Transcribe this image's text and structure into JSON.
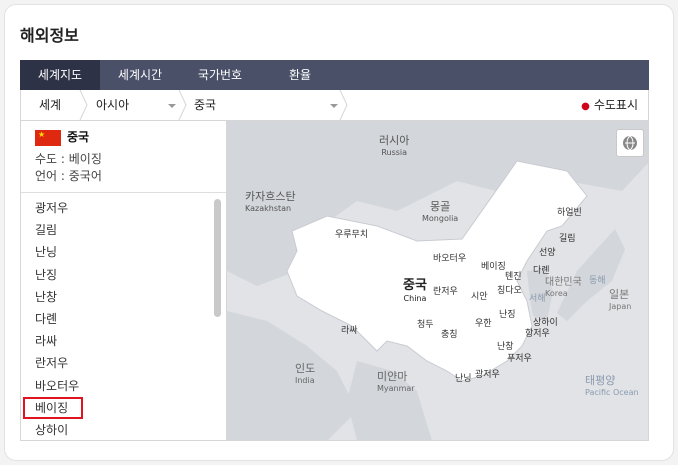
{
  "page": {
    "title": "해외정보"
  },
  "tabs": [
    {
      "label": "세계지도",
      "active": true
    },
    {
      "label": "세계시간",
      "active": false
    },
    {
      "label": "국가번호",
      "active": false
    },
    {
      "label": "환율",
      "active": false
    }
  ],
  "breadcrumb": {
    "world": "세계",
    "region": "아시아",
    "country": "중국"
  },
  "capital_toggle": "수도표시",
  "country_info": {
    "name": "중국",
    "capital": "수도 : 베이징",
    "language": "언어 : 중국어"
  },
  "cities": [
    "광저우",
    "길림",
    "난닝",
    "난징",
    "난창",
    "다롄",
    "라싸",
    "란저우",
    "바오터우",
    "베이징",
    "상하이"
  ],
  "selected_city": "베이징",
  "map": {
    "labels": {
      "russia_ko": "러시아",
      "russia_en": "Russia",
      "kazakhstan_ko": "카자흐스탄",
      "kazakhstan_en": "Kazakhstan",
      "mongolia_ko": "몽골",
      "mongolia_en": "Mongolia",
      "china_ko": "중국",
      "china_en": "China",
      "korea_ko": "대한민국",
      "korea_en": "Korea",
      "japan_ko": "일본",
      "japan_en": "Japan",
      "india_ko": "인도",
      "india_en": "India",
      "myanmar_ko": "미얀마",
      "myanmar_en": "Myanmar",
      "pacific_ko": "태평양",
      "pacific_en": "Pacific Ocean",
      "east_sea": "동해",
      "west_sea": "서해"
    },
    "city_labels": [
      "하얼빈",
      "길림",
      "선양",
      "우루무치",
      "바오터우",
      "베이징",
      "톈진",
      "다롄",
      "란저우",
      "시안",
      "칭다오",
      "라싸",
      "청두",
      "우한",
      "난징",
      "상하이",
      "충칭",
      "항저우",
      "난창",
      "푸저우",
      "난닝",
      "광저우"
    ]
  },
  "colors": {
    "tab_bg": "#4a5068",
    "tab_active": "#2e3246",
    "highlight": "#e0141e",
    "land": "#ffffff",
    "neighbor": "#d3d6da",
    "sea": "#e1e3e6"
  },
  "icons": {
    "globe": "globe-icon",
    "flag": "china-flag-icon"
  }
}
